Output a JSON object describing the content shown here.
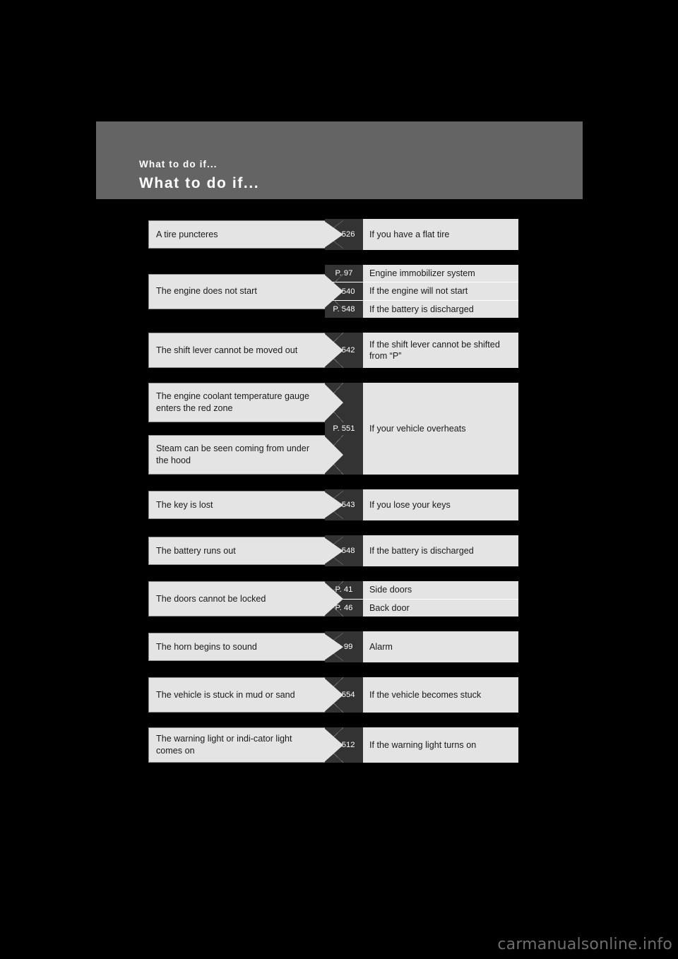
{
  "page": {
    "background_color": "#000000",
    "header_band_color": "#646464",
    "chip_fill_color": "#e4e4e4",
    "ref_fill_color": "#333333",
    "kicker": "What to do if...",
    "title": "What to do if..."
  },
  "watermark": "carmanualsonline.info",
  "rows": [
    {
      "causes": [
        "A tire puncteres"
      ],
      "entries": [
        {
          "page_ref": "P. 526",
          "description": "If you have a flat tire"
        }
      ]
    },
    {
      "causes": [
        "The engine does not start"
      ],
      "entries": [
        {
          "page_ref": "P. 97",
          "description": "Engine immobilizer system"
        },
        {
          "page_ref": "P. 540",
          "description": "If the engine will not start"
        },
        {
          "page_ref": "P. 548",
          "description": "If the battery is discharged"
        }
      ]
    },
    {
      "causes": [
        "The shift lever cannot be moved out"
      ],
      "entries": [
        {
          "page_ref": "P. 542",
          "description": "If the shift lever cannot be shifted from “P”"
        }
      ]
    },
    {
      "causes": [
        "The engine coolant temperature gauge enters the red zone",
        "Steam can be seen coming from under the hood"
      ],
      "entries": [
        {
          "page_ref": "P. 551",
          "description": "If your vehicle overheats"
        }
      ]
    },
    {
      "causes": [
        "The key is lost"
      ],
      "entries": [
        {
          "page_ref": "P. 543",
          "description": "If you lose your keys"
        }
      ]
    },
    {
      "causes": [
        "The battery runs out"
      ],
      "entries": [
        {
          "page_ref": "P. 548",
          "description": "If the battery is discharged"
        }
      ]
    },
    {
      "causes": [
        "The doors cannot be locked"
      ],
      "entries": [
        {
          "page_ref": "P. 41",
          "description": "Side doors"
        },
        {
          "page_ref": "P. 46",
          "description": "Back door"
        }
      ]
    },
    {
      "causes": [
        "The horn begins to sound"
      ],
      "entries": [
        {
          "page_ref": "P. 99",
          "description": "Alarm"
        }
      ]
    },
    {
      "causes": [
        "The vehicle is stuck in mud or sand"
      ],
      "entries": [
        {
          "page_ref": "P. 554",
          "description": "If the vehicle becomes stuck"
        }
      ]
    },
    {
      "causes": [
        "The warning light or indi-cator light comes on"
      ],
      "entries": [
        {
          "page_ref": "P. 512",
          "description": "If the warning light turns on"
        }
      ]
    }
  ]
}
